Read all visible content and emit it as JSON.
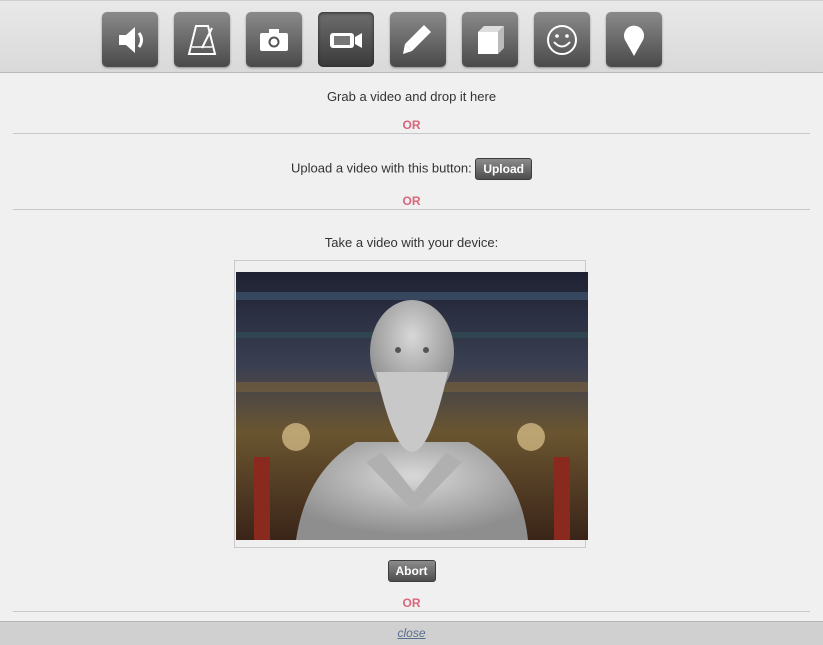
{
  "toolbar": {
    "tools": [
      {
        "name": "speaker-icon"
      },
      {
        "name": "metronome-icon"
      },
      {
        "name": "camera-icon"
      },
      {
        "name": "video-camera-icon",
        "active": true
      },
      {
        "name": "pencil-icon"
      },
      {
        "name": "cube-icon"
      },
      {
        "name": "smiley-icon"
      },
      {
        "name": "map-pin-icon"
      }
    ]
  },
  "drop": {
    "text": "Grab a video and drop it here"
  },
  "or_label": "OR",
  "upload": {
    "text": "Upload a video with this button:",
    "button_label": "Upload"
  },
  "capture": {
    "text": "Take a video with your device:",
    "abort_label": "Abort"
  },
  "footer": {
    "close_label": "close"
  },
  "colors": {
    "or": "#d9667a",
    "link": "#5a6f90"
  }
}
